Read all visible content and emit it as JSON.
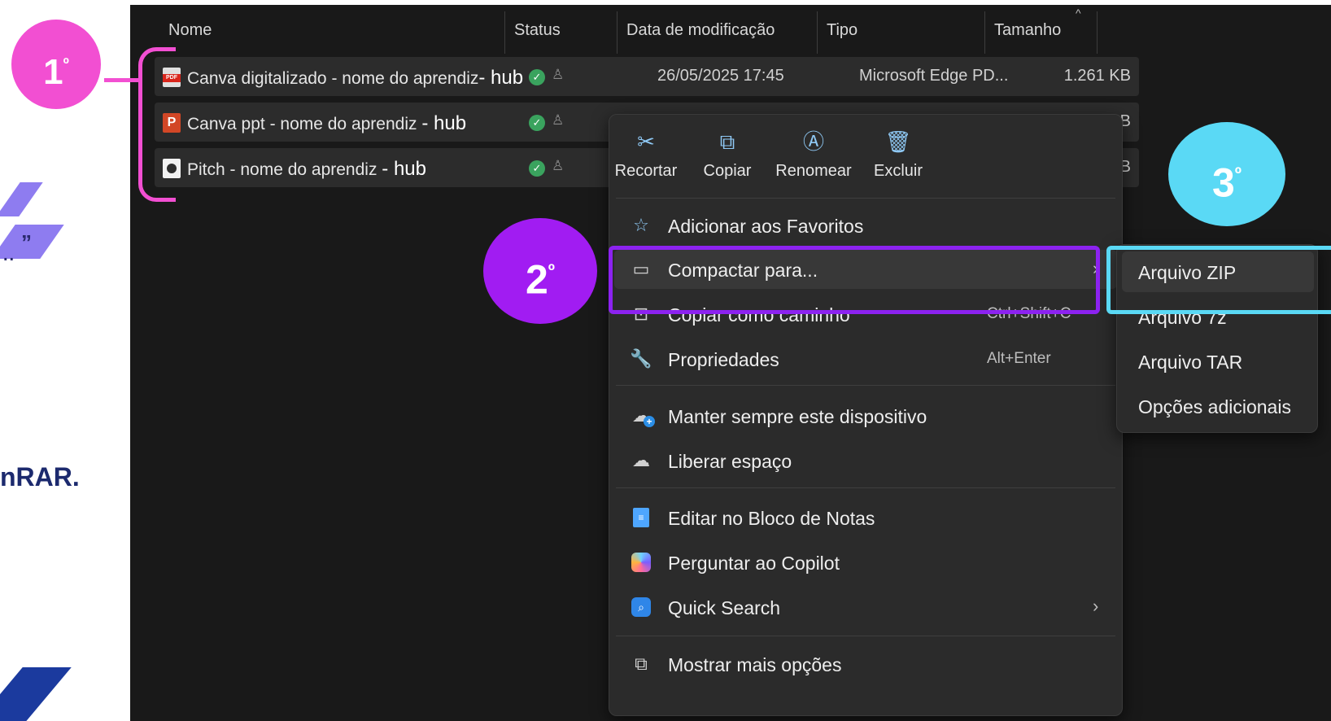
{
  "slide": {
    "quote_mark": "”",
    "dots": "..",
    "partial_text": "nRAR."
  },
  "explorer": {
    "columns": [
      "Nome",
      "Status",
      "Data de modificação",
      "Tipo",
      "Tamanho"
    ],
    "files": [
      {
        "name": "Canva digitalizado - nome do aprendiz",
        "suffix": "- hub",
        "icon": "pdf-file-icon",
        "date": "26/05/2025 17:45",
        "type": "Microsoft Edge PD...",
        "size": "1.261 KB"
      },
      {
        "name": "Canva ppt - nome do aprendiz ",
        "suffix": "- hub",
        "icon": "ppt-file-icon",
        "size_fragment": "B"
      },
      {
        "name": "Pitch - nome do aprendiz ",
        "suffix": " - hub",
        "icon": "video-file-icon",
        "size_fragment": "B"
      }
    ]
  },
  "context_menu": {
    "quick_actions": [
      {
        "label": "Recortar",
        "icon": "cut-icon"
      },
      {
        "label": "Copiar",
        "icon": "copy-icon"
      },
      {
        "label": "Renomear",
        "icon": "rename-icon"
      },
      {
        "label": "Excluir",
        "icon": "trash-icon"
      }
    ],
    "items": {
      "favorites": {
        "label": "Adicionar aos Favoritos",
        "icon": "star-icon"
      },
      "compress": {
        "label": "Compactar para...",
        "icon": "zip-folder-icon"
      },
      "copy_path": {
        "label": "Copiar como caminho",
        "shortcut": "Ctrl+Shift+C",
        "icon": "path-icon"
      },
      "properties": {
        "label": "Propriedades",
        "shortcut": "Alt+Enter",
        "icon": "wrench-icon"
      },
      "keep_device": {
        "label": "Manter sempre este dispositivo",
        "icon": "cloud-sync-icon"
      },
      "free_space": {
        "label": "Liberar espaço",
        "icon": "cloud-icon"
      },
      "notepad": {
        "label": "Editar no Bloco de Notas",
        "icon": "notepad-icon"
      },
      "copilot": {
        "label": "Perguntar ao Copilot",
        "icon": "copilot-icon"
      },
      "quick_search": {
        "label": "Quick Search",
        "icon": "quick-search-icon"
      },
      "more_options": {
        "label": "Mostrar mais opções",
        "icon": "more-options-icon"
      }
    }
  },
  "submenu": {
    "items": [
      "Arquivo ZIP",
      "Arquivo 7z",
      "Arquivo TAR",
      "Opções adicionais"
    ]
  },
  "annotations": {
    "step1": "1",
    "step2": "2",
    "step3": "3",
    "ordinal": "º"
  },
  "colors": {
    "step1": "#f24fd2",
    "step2": "#a11cf2",
    "step3": "#5ad9f5",
    "explorer_bg": "#191919",
    "menu_bg": "#2b2b2b"
  }
}
